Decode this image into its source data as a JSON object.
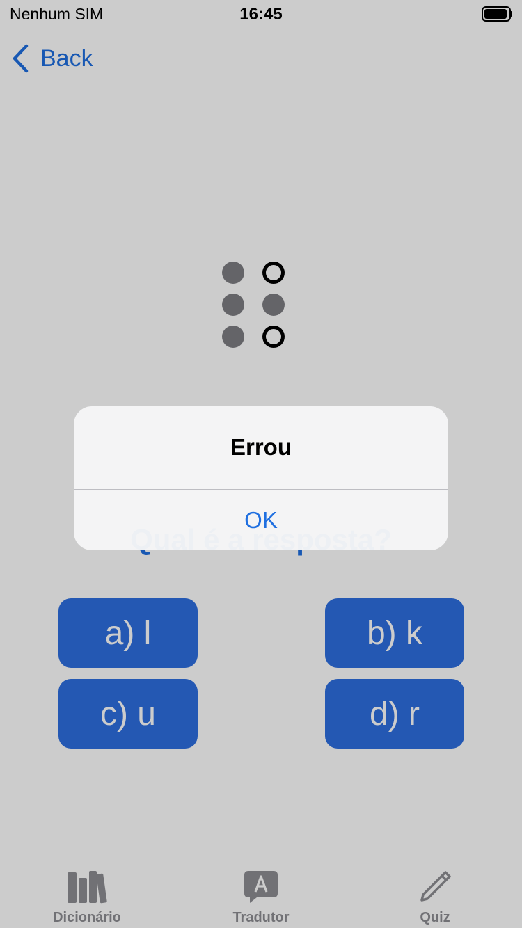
{
  "status_bar": {
    "carrier": "Nenhum SIM",
    "time": "16:45",
    "battery_icon": "battery-full-icon"
  },
  "nav": {
    "back_label": "Back",
    "back_icon": "chevron-left-icon"
  },
  "braille": {
    "cell_icon": "braille-cell",
    "dots": [
      {
        "position": 1,
        "raised": true
      },
      {
        "position": 4,
        "raised": false
      },
      {
        "position": 2,
        "raised": true
      },
      {
        "position": 5,
        "raised": true
      },
      {
        "position": 3,
        "raised": true
      },
      {
        "position": 6,
        "raised": false
      }
    ]
  },
  "quiz": {
    "question": "Qual é a resposta?",
    "answers": [
      {
        "label": "a) l"
      },
      {
        "label": "b) k"
      },
      {
        "label": "c) u"
      },
      {
        "label": "d) r"
      }
    ]
  },
  "tab_bar": {
    "tabs": [
      {
        "label": "Dicionário",
        "icon": "books-icon"
      },
      {
        "label": "Tradutor",
        "icon": "speech-bubble-a-icon"
      },
      {
        "label": "Quiz",
        "icon": "pencil-icon"
      }
    ]
  },
  "alert": {
    "title": "Errou",
    "ok_label": "OK"
  },
  "colors": {
    "accent": "#1f6fe0",
    "button_bg": "#2d6fe0",
    "dot_raised": "#7d7d82",
    "tab_inactive": "#8e8e93"
  }
}
